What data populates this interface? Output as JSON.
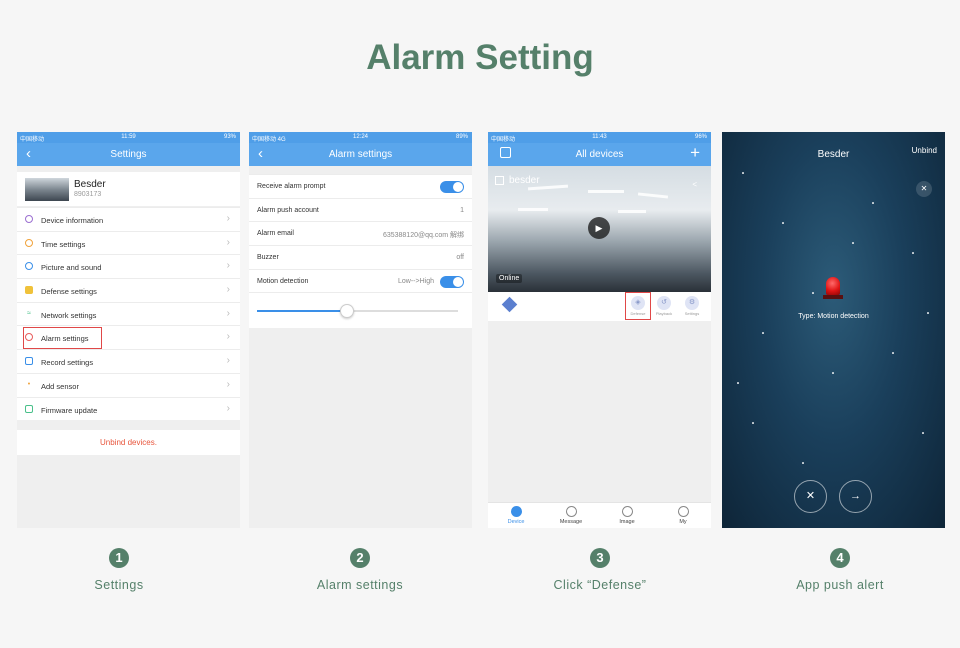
{
  "title": "Alarm Setting",
  "phone1": {
    "status": {
      "left": "中国移动",
      "time": "11:59",
      "right": "93%"
    },
    "nav_title": "Settings",
    "device_name": "Besder",
    "device_id": "8903173",
    "items": [
      {
        "label": "Device information",
        "icon": "info-icon",
        "color": "#9b6fd1"
      },
      {
        "label": "Time settings",
        "icon": "clock-icon",
        "color": "#f0a23a"
      },
      {
        "label": "Picture and sound",
        "icon": "picture-icon",
        "color": "#3a8fe8"
      },
      {
        "label": "Defense settings",
        "icon": "shield-icon",
        "color": "#f0c23a"
      },
      {
        "label": "Network settings",
        "icon": "wifi-icon",
        "color": "#49c08a"
      },
      {
        "label": "Alarm settings",
        "icon": "bell-icon",
        "color": "#e85c5c"
      },
      {
        "label": "Record settings",
        "icon": "video-icon",
        "color": "#3a8fe8"
      },
      {
        "label": "Add sensor",
        "icon": "sensor-icon",
        "color": "#f0a23a"
      },
      {
        "label": "Firmware update",
        "icon": "firmware-icon",
        "color": "#49c08a"
      }
    ],
    "unbind": "Unbind devices."
  },
  "phone2": {
    "status": {
      "left": "中国移动 4G",
      "time": "12:24",
      "right": "89%"
    },
    "nav_title": "Alarm settings",
    "rows": {
      "receive": "Receive alarm prompt",
      "push_label": "Alarm  push account",
      "push_value": "1",
      "email_label": "Alarm email",
      "email_value": "635388120@qq.com  解绑",
      "buzzer_label": "Buzzer",
      "buzzer_value": "off",
      "motion_label": "Motion detection",
      "motion_value": "Low-->High"
    },
    "sensitivity": 0.45
  },
  "phone3": {
    "status": {
      "left": "中国移动",
      "time": "11:43",
      "right": "96%"
    },
    "nav_title": "All devices",
    "camera_name": "besder",
    "online": "Online",
    "actions": [
      "Defense",
      "Playback",
      "Settings"
    ],
    "tabs": [
      "Device",
      "Message",
      "Image",
      "My"
    ]
  },
  "phone4": {
    "title": "Besder",
    "unbind": "Unbind",
    "alert": "Type:  Motion detection"
  },
  "steps": [
    {
      "num": "1",
      "label": "Settings"
    },
    {
      "num": "2",
      "label": "Alarm settings"
    },
    {
      "num": "3",
      "label": "Click “Defense”"
    },
    {
      "num": "4",
      "label": "App push alert"
    }
  ],
  "colors": {
    "accent": "#55806a",
    "nav": "#5aa6ec",
    "alert": "#e04848"
  }
}
